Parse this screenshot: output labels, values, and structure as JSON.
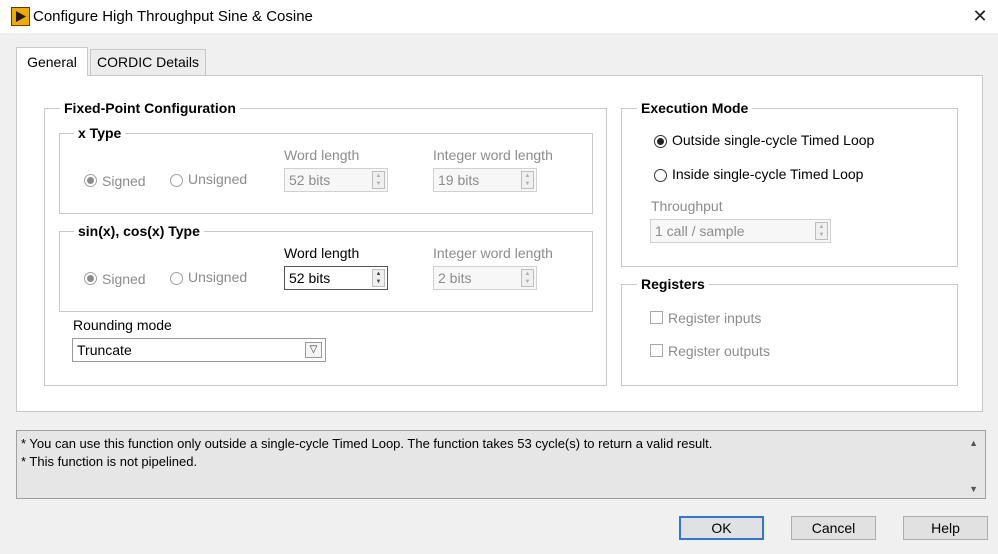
{
  "window": {
    "title": "Configure High Throughput Sine & Cosine",
    "close_glyph": "✕"
  },
  "tabs": [
    {
      "label": "General",
      "active": true
    },
    {
      "label": "CORDIC Details",
      "active": false
    }
  ],
  "fixed_point": {
    "legend": "Fixed-Point Configuration",
    "x_type": {
      "legend": "x Type",
      "signed_label": "Signed",
      "signed_selected": true,
      "unsigned_label": "Unsigned",
      "word_length_label": "Word length",
      "word_length_value": "52 bits",
      "integer_word_length_label": "Integer word length",
      "integer_word_length_value": "19 bits"
    },
    "sincos_type": {
      "legend": "sin(x), cos(x) Type",
      "signed_label": "Signed",
      "signed_selected": true,
      "unsigned_label": "Unsigned",
      "word_length_label": "Word length",
      "word_length_value": "52 bits",
      "integer_word_length_label": "Integer word length",
      "integer_word_length_value": "2 bits"
    },
    "rounding": {
      "label": "Rounding mode",
      "value": "Truncate"
    }
  },
  "execution_mode": {
    "legend": "Execution Mode",
    "outside_label": "Outside single-cycle Timed Loop",
    "outside_selected": true,
    "inside_label": "Inside single-cycle Timed Loop",
    "inside_selected": false,
    "throughput_label": "Throughput",
    "throughput_value": "1 call / sample"
  },
  "registers": {
    "legend": "Registers",
    "inputs_label": "Register inputs",
    "inputs_checked": false,
    "outputs_label": "Register outputs",
    "outputs_checked": false
  },
  "info": {
    "lines": [
      "* You can use this function only outside a single-cycle Timed Loop. The function takes 53 cycle(s) to return a valid result.",
      "* This function is not pipelined."
    ]
  },
  "buttons": {
    "ok": "OK",
    "cancel": "Cancel",
    "help": "Help"
  },
  "colors": {
    "accent": "#2a79d6",
    "icon": "#f2a900"
  }
}
